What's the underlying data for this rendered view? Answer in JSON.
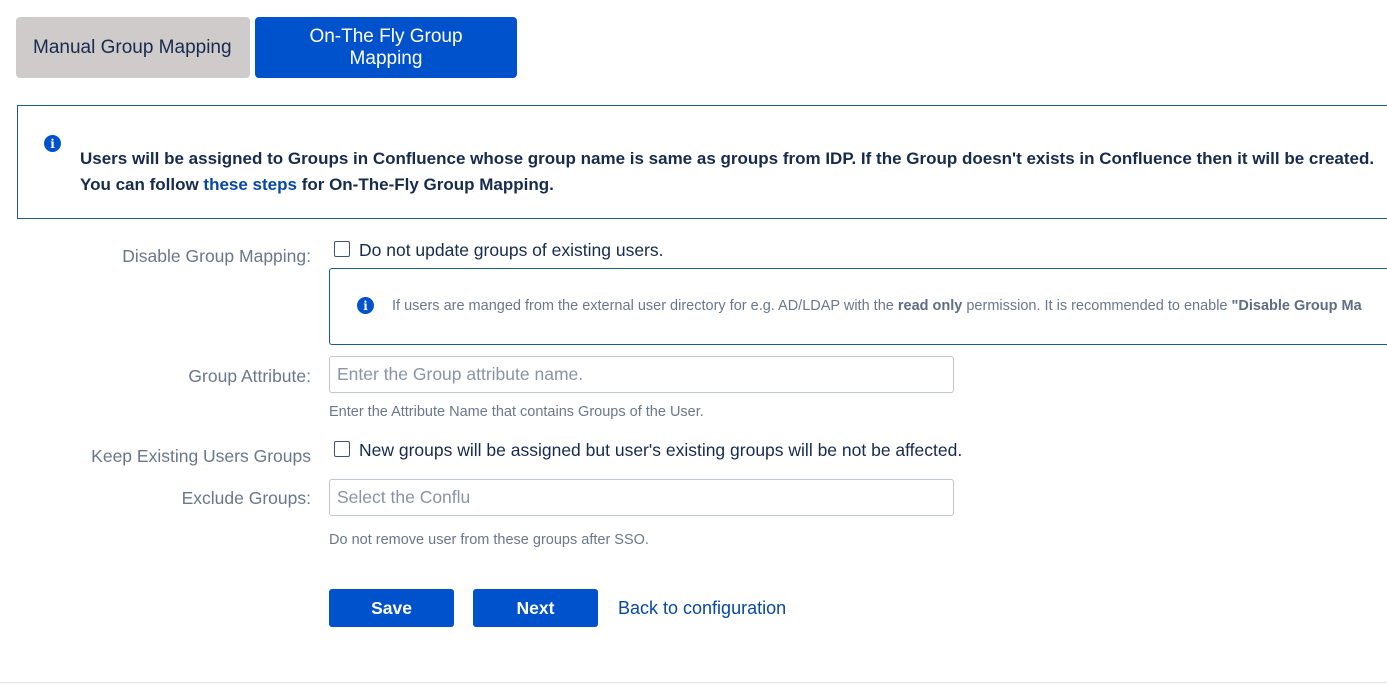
{
  "tabs": {
    "manual_label": "Manual Group Mapping",
    "onthefly_label": "On-The Fly Group Mapping"
  },
  "banner": {
    "icon": "info-icon",
    "line1": "Users will be assigned to Groups in Confluence whose group name is same as groups from IDP. If the Group doesn't exists in Confluence then it will be created.",
    "line2_prefix": "You can follow ",
    "line2_link": "these steps",
    "line2_suffix": " for On-The-Fly Group Mapping."
  },
  "form": {
    "disable_group_mapping": {
      "label": "Disable Group Mapping:",
      "checkbox_label": "Do not update groups of existing users.",
      "checked": false,
      "note_prefix": "If users are manged from the external user directory for e.g. AD/LDAP with the ",
      "note_bold1": "read only",
      "note_middle": " permission. It is recommended to enable ",
      "note_bold2": "\"Disable Group Ma"
    },
    "group_attribute": {
      "label": "Group Attribute:",
      "placeholder": "Enter the Group attribute name.",
      "value": "",
      "help": "Enter the Attribute Name that contains Groups of the User."
    },
    "keep_existing": {
      "label": "Keep Existing Users Groups",
      "checkbox_label": "New groups will be assigned but user's existing groups will be not be affected.",
      "checked": false
    },
    "exclude_groups": {
      "label": "Exclude Groups:",
      "placeholder": "Select the Conflu",
      "value": "",
      "help": "Do not remove user from these groups after SSO."
    }
  },
  "actions": {
    "save_label": "Save",
    "next_label": "Next",
    "back_label": "Back to configuration"
  },
  "colors": {
    "primary": "#0052cc",
    "tab_inactive": "#cfcbcb",
    "link": "#0747a6",
    "muted": "#6b778c"
  }
}
